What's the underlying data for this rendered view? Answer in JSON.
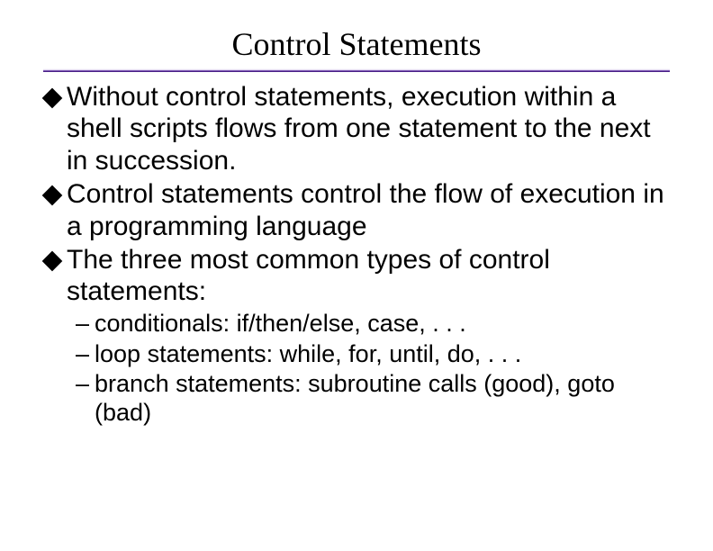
{
  "title": "Control Statements",
  "bullets": [
    "Without control statements, execution within a shell scripts flows from one statement to the next in succession.",
    "Control statements control the flow of execution in a programming language",
    "The three most common types of control statements:"
  ],
  "subs": [
    "conditionals:  if/then/else, case, . . .",
    "loop statements:  while, for, until, do, . . .",
    "branch statements:  subroutine calls (good), goto (bad)"
  ]
}
